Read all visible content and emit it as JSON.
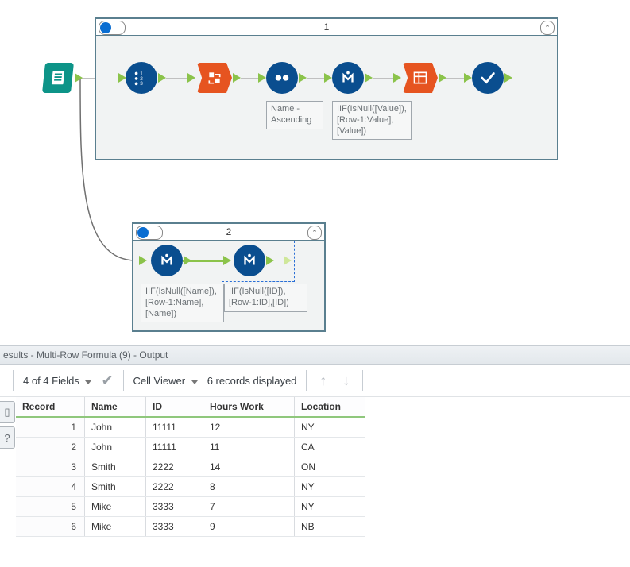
{
  "canvas": {
    "input_tool": "Input Data",
    "container1": {
      "title": "1",
      "annot_sort": "Name - Ascending",
      "annot_mrf": "IIF(IsNull([Value]),[Row-1:Value],[Value])"
    },
    "container2": {
      "title": "2",
      "annot_mrf_name": "IIF(IsNull([Name]),[Row-1:Name],[Name])",
      "annot_mrf_id": "IIF(IsNull([ID]),[Row-1:ID],[ID])"
    }
  },
  "results": {
    "title": "esults - Multi-Row Formula (9) - Output",
    "fields_label": "4 of 4 Fields",
    "cell_viewer_label": "Cell Viewer",
    "records_label": "6 records displayed",
    "columns": [
      "Record",
      "Name",
      "ID",
      "Hours Work",
      "Location"
    ],
    "rows": [
      {
        "n": 1,
        "name": "John",
        "id": "11111",
        "hours": "12",
        "loc": "NY"
      },
      {
        "n": 2,
        "name": "John",
        "id": "11111",
        "hours": "11",
        "loc": "CA"
      },
      {
        "n": 3,
        "name": "Smith",
        "id": "2222",
        "hours": "14",
        "loc": "ON"
      },
      {
        "n": 4,
        "name": "Smith",
        "id": "2222",
        "hours": "8",
        "loc": "NY"
      },
      {
        "n": 5,
        "name": "Mike",
        "id": "3333",
        "hours": "7",
        "loc": "NY"
      },
      {
        "n": 6,
        "name": "Mike",
        "id": "3333",
        "hours": "9",
        "loc": "NB"
      }
    ]
  }
}
